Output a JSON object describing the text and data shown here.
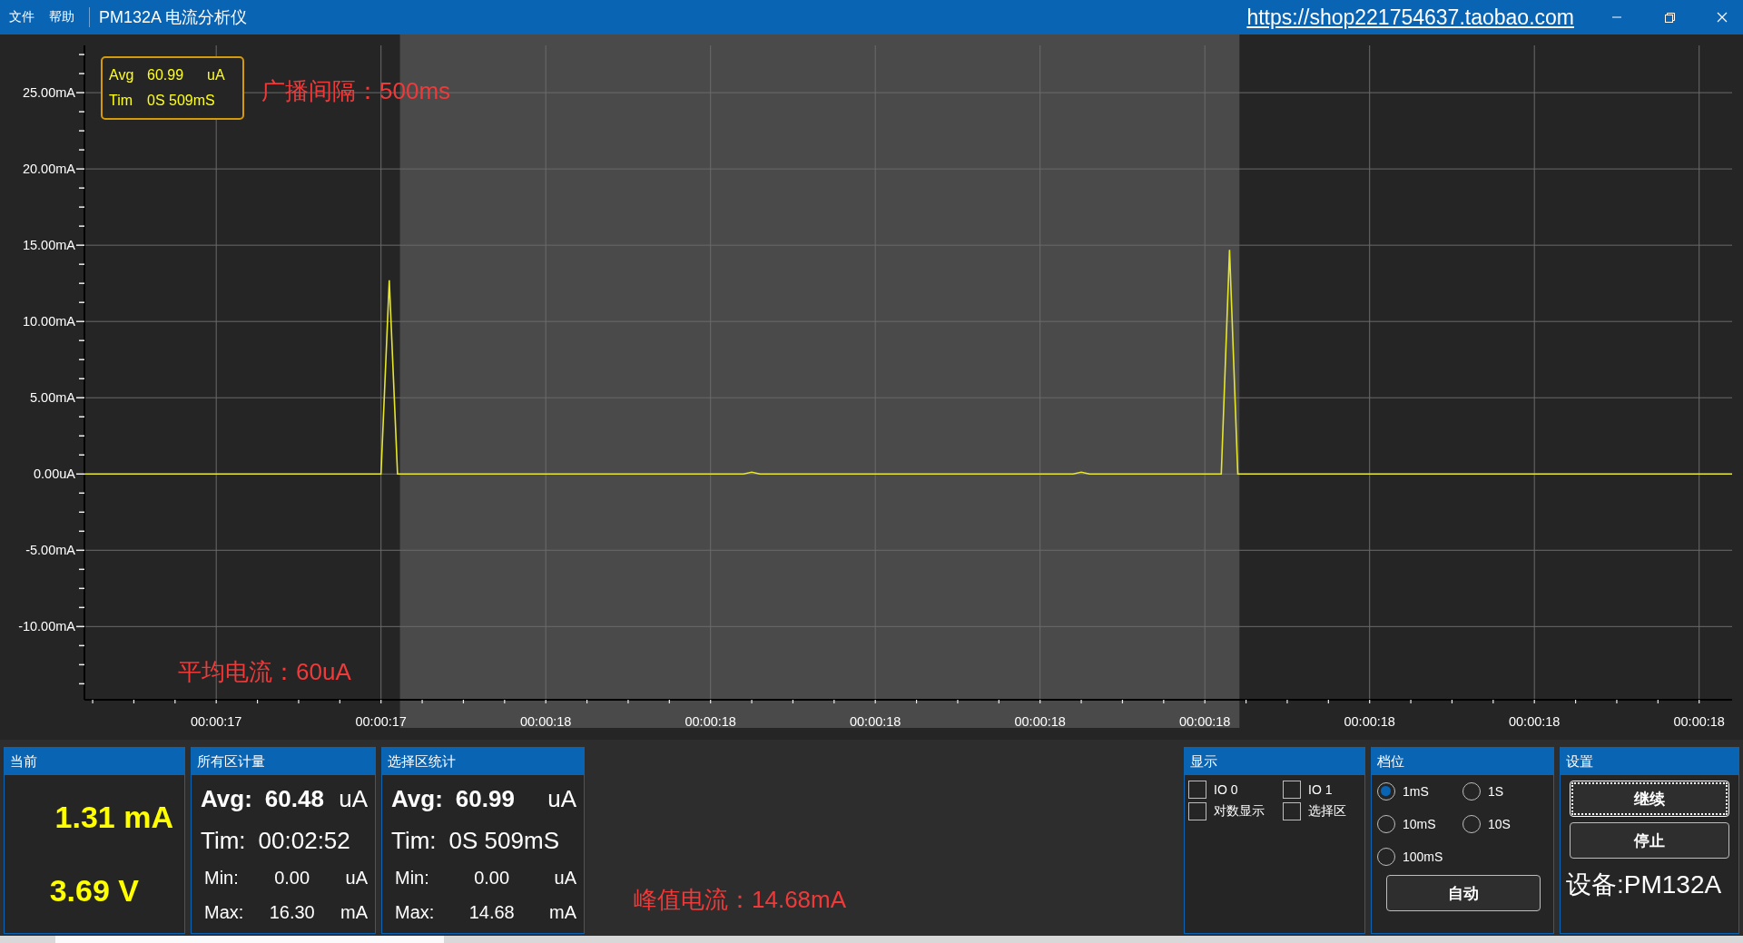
{
  "menu": [
    {
      "label": "文件"
    },
    {
      "label": "帮助"
    }
  ],
  "window": {
    "title": "PM132A 电流分析仪",
    "link": "https://shop221754637.taobao.com"
  },
  "chart": {
    "readout": [
      {
        "label": "Avg",
        "value": "60.99",
        "unit": "uA"
      },
      {
        "label": "Tim",
        "value": "0S 509mS"
      }
    ],
    "notes": [
      "广播间隔：500ms",
      "平均电流：60uA"
    ],
    "chart_data": {
      "type": "line",
      "grid": true,
      "ylim": [
        -14.8,
        28.1
      ],
      "categories": [
        null,
        null,
        null,
        null,
        null,
        null,
        null,
        null,
        null,
        null,
        null,
        null,
        null,
        null,
        null,
        null,
        "00:00:17",
        null,
        null,
        null,
        null,
        null,
        null,
        null,
        null,
        null,
        null,
        null,
        null,
        null,
        null,
        null,
        null,
        null,
        null,
        null,
        "00:00:17",
        null,
        null,
        null,
        null,
        null,
        null,
        null,
        null,
        null,
        null,
        null,
        null,
        null,
        null,
        null,
        null,
        null,
        null,
        null,
        "00:00:18",
        null,
        null,
        null,
        null,
        null,
        null,
        null,
        null,
        null,
        null,
        null,
        null,
        null,
        null,
        null,
        null,
        null,
        null,
        null,
        "00:00:18",
        null,
        null,
        null,
        null,
        null,
        null,
        null,
        null,
        null,
        null,
        null,
        null,
        null,
        null,
        null,
        null,
        null,
        null,
        null,
        "00:00:18",
        null,
        null,
        null,
        null,
        null,
        null,
        null,
        null,
        null,
        null,
        null,
        null,
        null,
        null,
        null,
        null,
        null,
        null,
        null,
        "00:00:18",
        null,
        null,
        null,
        null,
        null,
        null,
        null,
        null,
        null,
        null,
        null,
        null,
        null,
        null,
        null,
        null,
        null,
        null,
        null,
        "00:00:18",
        null,
        null,
        null,
        null,
        null,
        null,
        null,
        null,
        null,
        null,
        null,
        null,
        null,
        null,
        null,
        null,
        null,
        null,
        null,
        "00:00:18",
        null,
        null,
        null,
        null,
        null,
        null,
        null,
        null,
        null,
        null,
        null,
        null,
        null,
        null,
        null,
        null,
        null,
        null,
        null,
        "00:00:18",
        null,
        null,
        null,
        null,
        null,
        null,
        null,
        null,
        null,
        null,
        null,
        null,
        null,
        null,
        null,
        null,
        null,
        null,
        null,
        "00:00:18",
        null,
        null,
        null,
        null
      ],
      "series": [
        {
          "color": "#e6e62a",
          "values": [
            0,
            0,
            0,
            0,
            0,
            0,
            0,
            0,
            0,
            0,
            0,
            0,
            0,
            0,
            0,
            0,
            0,
            0,
            0,
            0,
            0,
            0,
            0,
            0,
            0,
            0,
            0,
            0,
            0,
            0,
            0,
            0,
            0,
            0,
            0,
            0,
            0,
            12.7,
            0,
            0,
            0,
            0,
            0,
            0,
            0,
            0,
            0,
            0,
            0,
            0,
            0,
            0,
            0,
            0,
            0,
            0,
            0,
            0,
            0,
            0,
            0,
            0,
            0,
            0,
            0,
            0,
            0,
            0,
            0,
            0,
            0,
            0,
            0,
            0,
            0,
            0,
            0,
            0,
            0,
            0,
            0,
            0.12,
            0,
            0,
            0,
            0,
            0,
            0,
            0,
            0,
            0,
            0,
            0,
            0,
            0,
            0,
            0,
            0,
            0,
            0,
            0,
            0,
            0,
            0,
            0,
            0,
            0,
            0,
            0,
            0,
            0,
            0,
            0,
            0,
            0,
            0,
            0,
            0,
            0,
            0,
            0,
            0.12,
            0,
            0,
            0,
            0,
            0,
            0,
            0,
            0,
            0,
            0,
            0,
            0,
            0,
            0,
            0,
            0,
            0,
            14.7,
            0,
            0,
            0,
            0,
            0,
            0,
            0,
            0,
            0,
            0,
            0,
            0,
            0,
            0,
            0,
            0,
            0,
            0,
            0,
            0,
            0,
            0,
            0,
            0,
            0,
            0,
            0,
            0,
            0,
            0,
            0,
            0,
            0,
            0,
            0,
            0,
            0,
            0,
            0,
            0,
            0,
            0,
            0,
            0,
            0,
            0,
            0,
            0,
            0,
            0,
            0,
            0,
            0,
            0,
            0,
            0,
            0,
            0,
            0,
            0,
            0
          ]
        }
      ],
      "yticks": [
        {
          "value": 25,
          "label": "25.00mA"
        },
        {
          "value": 20,
          "label": "20.00mA"
        },
        {
          "value": 15,
          "label": "15.00mA"
        },
        {
          "value": 10,
          "label": "10.00mA"
        },
        {
          "value": 5,
          "label": "5.00mA"
        },
        {
          "value": 0,
          "label": "0.00uA"
        },
        {
          "value": -5,
          "label": "-5.00mA"
        },
        {
          "value": -10,
          "label": "-10.00mA"
        }
      ]
    }
  },
  "current_panel": {
    "title": "当前",
    "readings": [
      "1.31 mA",
      "3.69 V"
    ]
  },
  "total_panel": {
    "title": "所有区计量",
    "rows": [
      {
        "kind": "bold",
        "label": "Avg:",
        "value": "60.48",
        "unit": "uA"
      },
      {
        "kind": "large",
        "label": "Tim:",
        "value": "00:02:52"
      },
      {
        "kind": "small",
        "label": "Min:",
        "value": "0.00",
        "unit": "uA"
      },
      {
        "kind": "small",
        "label": "Max:",
        "value": "16.30",
        "unit": "mA"
      }
    ]
  },
  "selection_panel": {
    "title": "选择区统计",
    "rows": [
      {
        "kind": "bold",
        "label": "Avg:",
        "value": "60.99",
        "unit": "uA"
      },
      {
        "kind": "large",
        "label": "Tim:",
        "value": "0S 509mS"
      },
      {
        "kind": "small",
        "label": "Min:",
        "value": "0.00",
        "unit": "uA"
      },
      {
        "kind": "small",
        "label": "Max:",
        "value": "14.68",
        "unit": "mA"
      }
    ]
  },
  "peak_note": "峰值电流：14.68mA",
  "display_panel": {
    "title": "显示",
    "checkboxes": [
      {
        "label": "IO 0",
        "checked": false
      },
      {
        "label": "IO 1",
        "checked": false
      },
      {
        "label": "对数显示",
        "checked": false
      },
      {
        "label": "选择区",
        "checked": false
      }
    ]
  },
  "range_panel": {
    "title": "档位",
    "options": [
      {
        "label": "1mS",
        "selected": true
      },
      {
        "label": "1S",
        "selected": false
      },
      {
        "label": "10mS",
        "selected": false
      },
      {
        "label": "10S",
        "selected": false
      },
      {
        "label": "100mS",
        "selected": false
      }
    ],
    "button": "自动"
  },
  "settings_panel": {
    "title": "设置",
    "buttons": [
      {
        "label": "继续",
        "focused": true
      },
      {
        "label": "停止",
        "focused": false
      }
    ],
    "device": "设备:PM132A"
  }
}
